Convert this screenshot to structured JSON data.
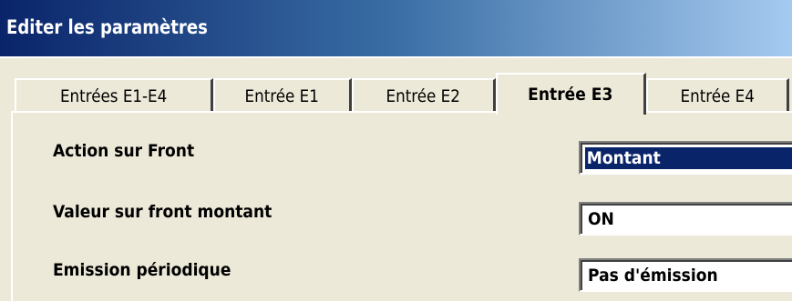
{
  "window": {
    "title": "Editer les paramètres"
  },
  "tabs": [
    {
      "label": "Entrées E1-E4",
      "active": false
    },
    {
      "label": "Entrée E1",
      "active": false
    },
    {
      "label": "Entrée E2",
      "active": false
    },
    {
      "label": "Entrée E3",
      "active": true
    },
    {
      "label": "Entrée E4",
      "active": false
    }
  ],
  "fields": [
    {
      "label": "Action sur Front",
      "value": "Montant",
      "selected": true
    },
    {
      "label": "Valeur sur front montant",
      "value": "ON",
      "selected": false
    },
    {
      "label": "Emission périodique",
      "value": "Pas d'émission",
      "selected": false
    }
  ],
  "colors": {
    "title_bar_start": "#0a246a",
    "title_bar_end": "#a6caf0",
    "selection": "#0a246a",
    "window_bg": "#ece9d8"
  }
}
